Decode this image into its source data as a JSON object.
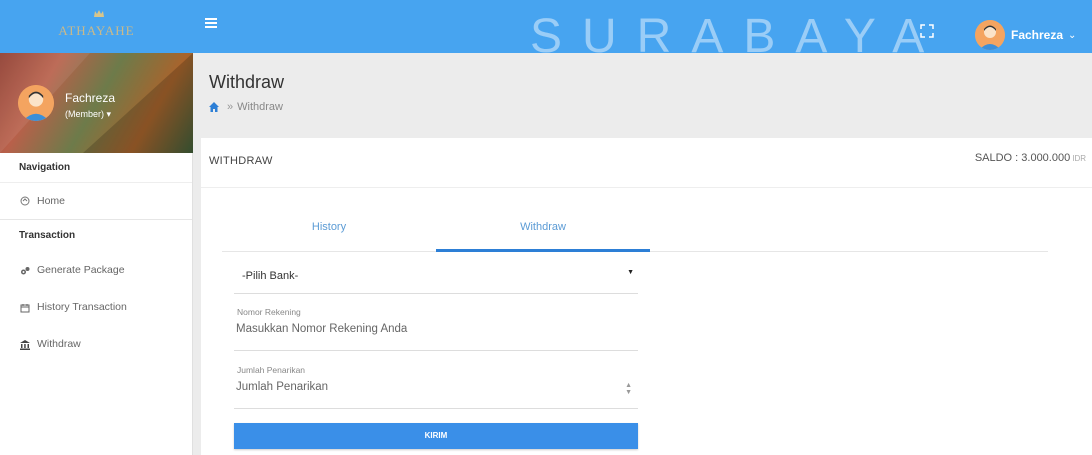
{
  "topbar": {
    "logo_text": "ATHAYAHE",
    "watermark": "SURABAYA",
    "user_name": "Fachreza",
    "chevron": "⌄",
    "colors": {
      "topbar": "#47a4f0",
      "accent": "#3a8fe8"
    }
  },
  "sidebar": {
    "profile": {
      "name": "Fachreza",
      "role": "(Member) ▾"
    },
    "nav_heading": "Navigation",
    "items": [
      {
        "label": "Home",
        "icon": "home-outline-icon"
      }
    ],
    "transaction_heading": "Transaction",
    "transaction_items": [
      {
        "label": "Generate Package",
        "icon": "gears-icon"
      },
      {
        "label": "History Transaction",
        "icon": "history-icon"
      },
      {
        "label": "Withdraw",
        "icon": "bank-icon"
      }
    ]
  },
  "header": {
    "title": "Withdraw",
    "breadcrumb_sep": "»",
    "breadcrumb_current": "Withdraw"
  },
  "card": {
    "title": "WITHDRAW",
    "saldo_label": "SALDO : 3.000.000",
    "saldo_currency": "IDR",
    "tabs": [
      {
        "label": "History",
        "active": false
      },
      {
        "label": "Withdraw",
        "active": true
      }
    ],
    "bank_select": {
      "value": "-Pilih Bank-",
      "arrow": "▼"
    },
    "nomor_rekening": {
      "label": "Nomor Rekening",
      "placeholder": "Masukkan Nomor Rekening Anda"
    },
    "jumlah": {
      "label": "Jumlah Penarikan",
      "placeholder": "Jumlah Penarikan"
    },
    "submit_label": "KIRIM"
  }
}
